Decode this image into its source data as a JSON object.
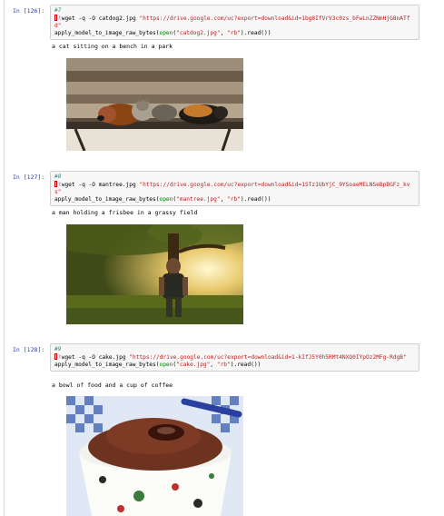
{
  "cells": [
    {
      "prompt": "In [126]:",
      "comment": "#7",
      "wget_cmd": "wget -q -O catdog2.jpg ",
      "url": "\"https://drive.google.com/uc?export=download&id=1bg8IfVrV3c0zs_bFwLnZZNmHjG8nATfd\"",
      "call_fn": "apply_model_to_image_raw_bytes(",
      "open_fn": "open",
      "open_args_a": "(",
      "filename": "\"catdog2.jpg\"",
      "sep": ", ",
      "mode": "\"rb\"",
      "tail": ").read())",
      "output": "a cat sitting on a bench in a park",
      "image_icon": "photo-cat-dog-on-bench"
    },
    {
      "prompt": "In [127]:",
      "comment": "#8",
      "wget_cmd": "wget -q -O mantree.jpg ",
      "url": "\"https://drive.google.com/uc?export=download&id=1STz1UbYjC_9YSoaeMELNSeBpBGFz_kvs\"",
      "call_fn": "apply_model_to_image_raw_bytes(",
      "open_fn": "open",
      "open_args_a": "(",
      "filename": "\"mantree.jpg\"",
      "sep": ", ",
      "mode": "\"rb\"",
      "tail": ").read())",
      "output": "a man holding a frisbee in a grassy field",
      "image_icon": "photo-man-under-tree"
    },
    {
      "prompt": "In [128]:",
      "comment": "#9",
      "wget_cmd": "wget -q -O cake.jpg ",
      "url": "\"https://drive.google.com/uc?export=download&id=1-kIfJ5Y0h5RMt4NXQ0IYpOz2MFg-RdgB\"",
      "call_fn": "apply_model_to_image_raw_bytes(",
      "open_fn": "open",
      "open_args_a": "(",
      "filename": "\"cake.jpg\"",
      "sep": ", ",
      "mode": "\"rb\"",
      "tail": ").read())",
      "output": "a bowl of food and a cup of coffee",
      "image_icon": "photo-lava-cake-cup"
    }
  ]
}
